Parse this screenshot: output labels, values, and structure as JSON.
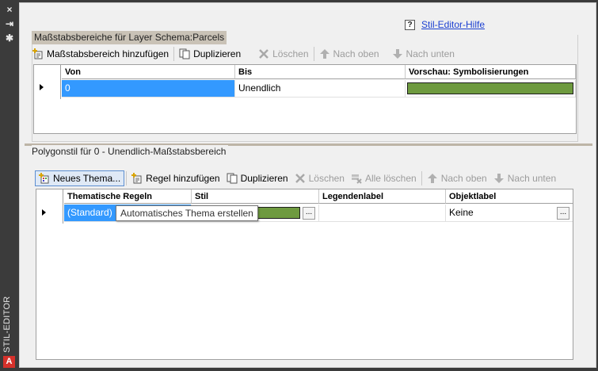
{
  "sidebar": {
    "close_icon": "×",
    "pin_icon": "⇥",
    "settings_icon": "✱",
    "title": "STIL-EDITOR",
    "logo_text": "A"
  },
  "help": {
    "icon": "?",
    "label": "Stil-Editor-Hilfe"
  },
  "scale_ranges": {
    "title": "Maßstabsbereiche für Layer Schema:Parcels",
    "toolbar": [
      {
        "label": "Maßstabsbereich hinzufügen",
        "icon": "add-scale-icon",
        "enabled": true
      },
      {
        "label": "Duplizieren",
        "icon": "duplicate-icon",
        "enabled": true
      },
      {
        "label": "Löschen",
        "icon": "delete-icon",
        "enabled": false
      },
      {
        "label": "Nach oben",
        "icon": "arrow-up-icon",
        "enabled": false
      },
      {
        "label": "Nach unten",
        "icon": "arrow-down-icon",
        "enabled": false
      }
    ],
    "columns": [
      "Von",
      "Bis",
      "Vorschau: Symbolisierungen"
    ],
    "rows": [
      {
        "von": "0",
        "bis": "Unendlich",
        "preview_color": "#6e9a3f"
      }
    ]
  },
  "polygon_style": {
    "title": "Polygonstil für 0 - Unendlich-Maßstabsbereich",
    "toolbar": [
      {
        "label": "Neues Thema...",
        "icon": "new-theme-icon",
        "enabled": true
      },
      {
        "label": "Regel hinzufügen",
        "icon": "add-rule-icon",
        "enabled": true
      },
      {
        "label": "Duplizieren",
        "icon": "duplicate-icon",
        "enabled": true
      },
      {
        "label": "Löschen",
        "icon": "delete-icon",
        "enabled": false
      },
      {
        "label": "Alle löschen",
        "icon": "delete-all-icon",
        "enabled": false
      },
      {
        "label": "Nach oben",
        "icon": "arrow-up-icon",
        "enabled": false
      },
      {
        "label": "Nach unten",
        "icon": "arrow-down-icon",
        "enabled": false
      }
    ],
    "columns": [
      "Thematische Regeln",
      "Stil",
      "Legendenlabel",
      "Objektlabel"
    ],
    "rows": [
      {
        "rule": "(Standard)",
        "style_color": "#6e9a3f",
        "legend": "",
        "object_label": "Keine"
      }
    ],
    "ellipsis": "...",
    "tooltip": "Automatisches Thema erstellen"
  }
}
